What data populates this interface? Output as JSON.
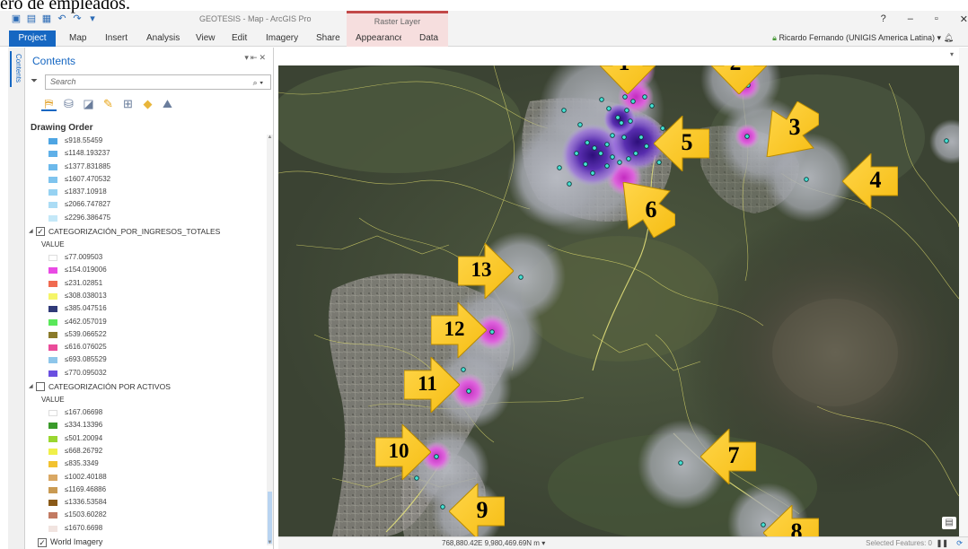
{
  "caption": "ero de empleados.",
  "titlebar": {
    "title": "GEOTESIS - Map - ArcGIS Pro",
    "context_group": "Raster Layer",
    "controls": [
      "?",
      "–",
      "▫",
      "✕"
    ]
  },
  "ribbon": {
    "tabs": [
      "Project",
      "Map",
      "Insert",
      "Analysis",
      "View",
      "Edit",
      "Imagery",
      "Share",
      "Appearance",
      "Data"
    ],
    "user": "Ricardo Fernando (UNIGIS America Latina)"
  },
  "sidebar": {
    "tab_label": "Contents"
  },
  "contents": {
    "title": "Contents",
    "search_placeholder": "Search",
    "drawing_order_label": "Drawing Order",
    "top_legend": [
      {
        "label": "≤918.55459",
        "color": "#4ea5e3"
      },
      {
        "label": "≤1148.193237",
        "color": "#5fb0e8"
      },
      {
        "label": "≤1377.831885",
        "color": "#6cb9eb"
      },
      {
        "label": "≤1607.470532",
        "color": "#7fc4ee"
      },
      {
        "label": "≤1837.10918",
        "color": "#96d2f2"
      },
      {
        "label": "≤2066.747827",
        "color": "#abdcf5"
      },
      {
        "label": "≤2296.386475",
        "color": "#c4e8f8"
      }
    ],
    "layer1": {
      "name": "CATEGORIZACIÓN_POR_INGRESOS_TOTALES",
      "checked": "✓",
      "value_label": "VALUE",
      "items": [
        {
          "label": "≤77.009503",
          "color": "#ffffff"
        },
        {
          "label": "≤154.019006",
          "color": "#e94ae4"
        },
        {
          "label": "≤231.02851",
          "color": "#f06a50"
        },
        {
          "label": "≤308.038013",
          "color": "#f5f568"
        },
        {
          "label": "≤385.047516",
          "color": "#303a78"
        },
        {
          "label": "≤462.057019",
          "color": "#5ae85a"
        },
        {
          "label": "≤539.066522",
          "color": "#8a7a2a"
        },
        {
          "label": "≤616.076025",
          "color": "#ea4c9a"
        },
        {
          "label": "≤693.085529",
          "color": "#8ec6ea"
        },
        {
          "label": "≤770.095032",
          "color": "#6a4fe0"
        }
      ]
    },
    "layer2": {
      "name": "CATEGORIZACIÓN POR ACTIVOS",
      "checked": "",
      "value_label": "VALUE",
      "items": [
        {
          "label": "≤167.06698",
          "color": "#ffffff"
        },
        {
          "label": "≤334.13396",
          "color": "#3a9a2a"
        },
        {
          "label": "≤501.20094",
          "color": "#9ad630"
        },
        {
          "label": "≤668.26792",
          "color": "#f0f04a"
        },
        {
          "label": "≤835.3349",
          "color": "#f2c230"
        },
        {
          "label": "≤1002.40188",
          "color": "#d9a864"
        },
        {
          "label": "≤1169.46886",
          "color": "#c99a52"
        },
        {
          "label": "≤1336.53584",
          "color": "#8a5a18"
        },
        {
          "label": "≤1503.60282",
          "color": "#c27a62"
        },
        {
          "label": "≤1670.6698",
          "color": "#f1e4e0"
        }
      ]
    },
    "world_imagery": "World Imagery"
  },
  "map": {
    "coordinates": "768,880.42E 9,980,469.69N m",
    "selected_features": "Selected Features: 0",
    "arrow_numbers": [
      "1",
      "2",
      "3",
      "4",
      "5",
      "6",
      "7",
      "8",
      "9",
      "10",
      "11",
      "12",
      "13"
    ]
  },
  "colors": {
    "accent": "#1667c2",
    "arrow_fill": "#f6bd13",
    "hotspot_magenta": "#e94ae4",
    "hotspot_purple": "#4b1f9e",
    "point_cyan": "#45e4d6"
  }
}
